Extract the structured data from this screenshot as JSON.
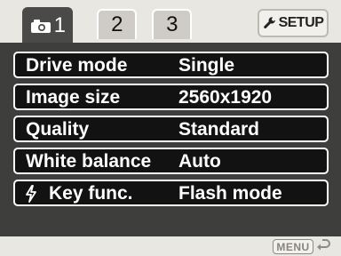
{
  "tabs": [
    {
      "id": "tab-1",
      "label": "1",
      "icon": "camera-icon",
      "active": true
    },
    {
      "id": "tab-2",
      "label": "2",
      "active": false
    },
    {
      "id": "tab-3",
      "label": "3",
      "active": false
    },
    {
      "id": "tab-setup",
      "label": "SETUP",
      "icon": "wrench-icon",
      "active": false
    }
  ],
  "menu": {
    "rows": [
      {
        "label": "Drive mode",
        "value": "Single"
      },
      {
        "label": "Image size",
        "value": "2560x1920"
      },
      {
        "label": "Quality",
        "value": "Standard"
      },
      {
        "label": "White balance",
        "value": "Auto"
      },
      {
        "label": "Key func.",
        "value": "Flash mode",
        "icon": "flash-icon"
      }
    ]
  },
  "footer": {
    "menu_button": "MENU",
    "back_icon": "return-arrow-icon"
  },
  "colors": {
    "active_tab": "#4a4a48",
    "inactive_tab": "#cfccc7",
    "row_background": "#121212",
    "panel_background": "#3e3e3c",
    "chrome_background": "#e9e7e2"
  }
}
